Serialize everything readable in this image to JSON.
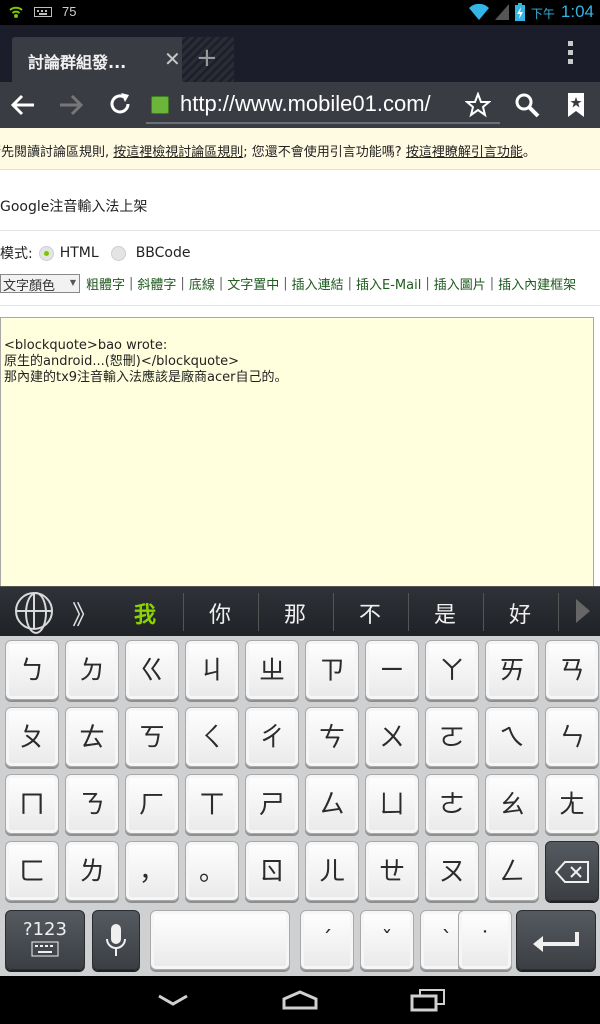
{
  "status_bar": {
    "notification_count": "75",
    "time_prefix": "下午",
    "time": "1:04"
  },
  "browser": {
    "tab_title": "討論群組發...",
    "url": "http://www.mobile01.com/"
  },
  "page": {
    "notice": {
      "prefix": "請先閱讀討論區規則, ",
      "link1": "按這裡檢視討論區規則",
      "middle": "; 您還不會使用引言功能嗎? ",
      "link2": "按這裡瞭解引言功能",
      "suffix": "。"
    },
    "topic_title": "Google注音輸入法上架",
    "mode": {
      "label": "模式:",
      "options": [
        "HTML",
        "BBCode"
      ],
      "selected": "HTML"
    },
    "toolbar": {
      "color_select": "文字顏色",
      "buttons": [
        "粗體字",
        "斜體字",
        "底線",
        "文字置中",
        "插入連結",
        "插入E-Mail",
        "插入圖片",
        "插入內建框架"
      ]
    },
    "editor_lines": [
      "<blockquote>bao wrote:",
      "原生的android...(恕刪)</blockquote>",
      "那內建的tx9注音輸入法應該是廠商acer自己的。"
    ]
  },
  "ime": {
    "candidates": [
      "我",
      "你",
      "那",
      "不",
      "是",
      "好"
    ],
    "rows": [
      [
        "ㄅ",
        "ㄉ",
        "ㄍ",
        "ㄐ",
        "ㄓ",
        "ㄗ",
        "ㄧ",
        "ㄚ",
        "ㄞ",
        "ㄢ"
      ],
      [
        "ㄆ",
        "ㄊ",
        "ㄎ",
        "ㄑ",
        "ㄔ",
        "ㄘ",
        "ㄨ",
        "ㄛ",
        "ㄟ",
        "ㄣ"
      ],
      [
        "ㄇ",
        "ㄋ",
        "ㄏ",
        "ㄒ",
        "ㄕ",
        "ㄙ",
        "ㄩ",
        "ㄜ",
        "ㄠ",
        "ㄤ"
      ],
      [
        "ㄈ",
        "ㄌ",
        "，",
        "。",
        "ㄖ",
        "ㄦ",
        "ㄝ",
        "ㄡ",
        "ㄥ"
      ]
    ],
    "symbols_key": "?123",
    "tone_keys": [
      "ˊ",
      "ˇ",
      "ˋ",
      "˙"
    ]
  }
}
